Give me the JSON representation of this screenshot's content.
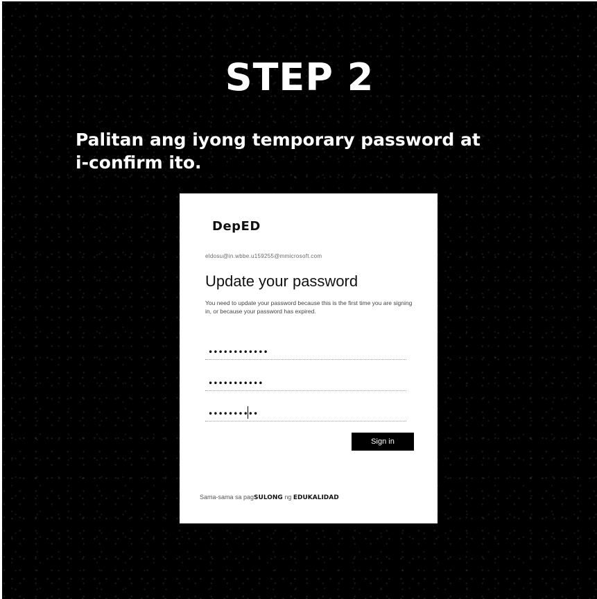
{
  "step": {
    "title": "STEP 2"
  },
  "instruction": "Palitan ang iyong temporary password at i-confirm ito.",
  "card": {
    "logo": "DepED",
    "account": "eldosu@in.wbbe.u159255@mmicrosoft.com",
    "heading": "Update your password",
    "description": "You need to update your password because this is the first time you are signing in, or because your password has expired.",
    "current_password": "••••••••••••",
    "new_password": "•••••••••••",
    "confirm_password": "••••••••••",
    "sign_in_label": "Sign in",
    "footer_prefix": "Sama-sama sa pag",
    "footer_sulong": "SULONG",
    "footer_mid": " ng ",
    "footer_edukalidad": "EDUKALIDAD"
  }
}
